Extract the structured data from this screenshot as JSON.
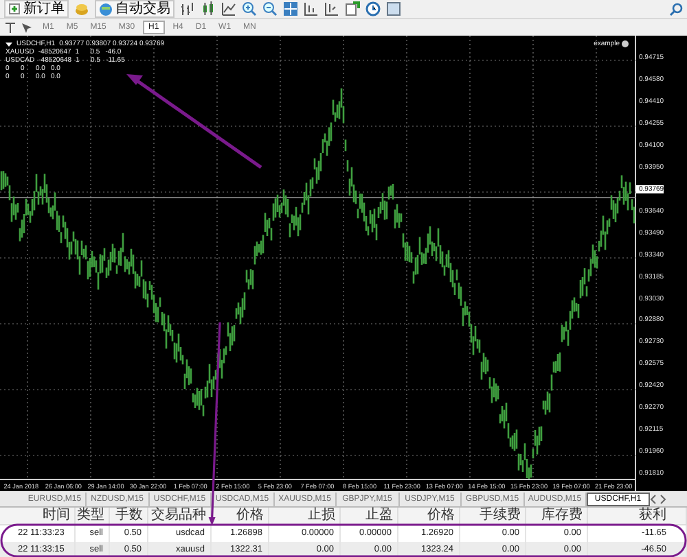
{
  "toolbar": {
    "buttons": [
      {
        "label": "新订单"
      },
      {
        "label": "自动交易"
      }
    ],
    "timeframes": [
      {
        "label": "M1",
        "selected": false
      },
      {
        "label": "M5",
        "selected": false
      },
      {
        "label": "M15",
        "selected": false
      },
      {
        "label": "M30",
        "selected": false
      },
      {
        "label": "H1",
        "selected": true
      },
      {
        "label": "H4",
        "selected": false
      },
      {
        "label": "D1",
        "selected": false
      },
      {
        "label": "W1",
        "selected": false
      },
      {
        "label": "MN",
        "selected": false
      }
    ]
  },
  "chart": {
    "title": "USDCHF,H1",
    "ohlc": "0.93777 0.93807 0.93724 0.93769",
    "rows": [
      [
        "XAUUSD",
        "-48520647",
        "1",
        "0.5",
        "-46.0"
      ],
      [
        "USDCAD",
        "-48520648",
        "1",
        "0.5",
        "-11.65"
      ],
      [
        "0",
        "0",
        "0.0",
        "0.0"
      ],
      [
        "0",
        "0",
        "0.0",
        "0.0"
      ]
    ],
    "expert": "example",
    "price_labels": [
      "0.94715",
      "0.94580",
      "0.94410",
      "0.94255",
      "0.94100",
      "0.93950",
      "0.93640",
      "0.93490",
      "0.93340",
      "0.93185",
      "0.93030",
      "0.92880",
      "0.92730",
      "0.92575",
      "0.92420",
      "0.92270",
      "0.92115",
      "0.91960",
      "0.91810"
    ],
    "current_price": "0.93769",
    "time_labels": [
      "24 Jan 2018",
      "26 Jan 06:00",
      "29 Jan 14:00",
      "30 Jan 22:00",
      "1 Feb 07:00",
      "2 Feb 15:00",
      "5 Feb 23:00",
      "7 Feb 07:00",
      "8 Feb 15:00",
      "11 Feb 23:00",
      "13 Feb 07:00",
      "14 Feb 15:00",
      "15 Feb 23:00",
      "19 Feb 07:00",
      "21 Feb 23:00"
    ]
  },
  "tabs": [
    {
      "label": "EURUSD,M15",
      "selected": false
    },
    {
      "label": "NZDUSD,M15",
      "selected": false
    },
    {
      "label": "USDCHF,M15",
      "selected": false
    },
    {
      "label": "USDCAD,M15",
      "selected": false
    },
    {
      "label": "XAUUSD,M15",
      "selected": false
    },
    {
      "label": "GBPJPY,M15",
      "selected": false
    },
    {
      "label": "USDJPY,M15",
      "selected": false
    },
    {
      "label": "GBPUSD,M15",
      "selected": false
    },
    {
      "label": "AUDUSD,M15",
      "selected": false
    },
    {
      "label": "USDCHF,H1",
      "selected": true
    }
  ],
  "trades": {
    "columns": [
      "时间",
      "类型",
      "手数",
      "交易品种",
      "价格",
      "止损",
      "止盈",
      "价格",
      "手续费",
      "库存费",
      "获利"
    ],
    "rows": [
      [
        "22 11:33:23",
        "sell",
        "0.50",
        "usdcad",
        "1.26898",
        "0.00000",
        "0.00000",
        "1.26920",
        "0.00",
        "0.00",
        "-11.65"
      ],
      [
        "22 11:33:15",
        "sell",
        "0.50",
        "xauusd",
        "1322.31",
        "0.00",
        "0.00",
        "1323.24",
        "0.00",
        "0.00",
        "-46.50"
      ]
    ]
  }
}
